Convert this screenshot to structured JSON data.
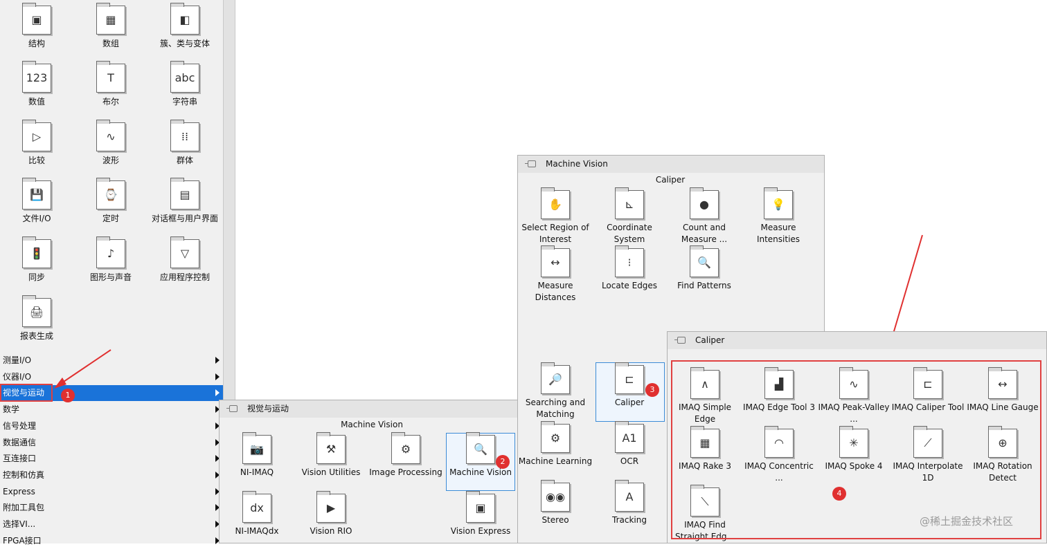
{
  "left_palette": {
    "grid_items": [
      {
        "label": "结构",
        "icon": "structure-icon",
        "glyph": "▣"
      },
      {
        "label": "数组",
        "icon": "array-icon",
        "glyph": "▦"
      },
      {
        "label": "簇、类与变体",
        "icon": "cluster-icon",
        "glyph": "◧"
      },
      {
        "label": "数值",
        "icon": "numeric-icon",
        "glyph": "123"
      },
      {
        "label": "布尔",
        "icon": "boolean-icon",
        "glyph": "T"
      },
      {
        "label": "字符串",
        "icon": "string-icon",
        "glyph": "abc"
      },
      {
        "label": "比较",
        "icon": "comparison-icon",
        "glyph": "▷"
      },
      {
        "label": "波形",
        "icon": "waveform-icon",
        "glyph": "∿"
      },
      {
        "label": "群体",
        "icon": "group-icon",
        "glyph": "⁞⁞"
      },
      {
        "label": "文件I/O",
        "icon": "file-io-icon",
        "glyph": "💾"
      },
      {
        "label": "定时",
        "icon": "timing-icon",
        "glyph": "⌚"
      },
      {
        "label": "对话框与用户界面",
        "icon": "dialog-ui-icon",
        "glyph": "▤"
      },
      {
        "label": "同步",
        "icon": "sync-icon",
        "glyph": "🚦"
      },
      {
        "label": "图形与声音",
        "icon": "graphics-sound-icon",
        "glyph": "♪"
      },
      {
        "label": "应用程序控制",
        "icon": "app-control-icon",
        "glyph": "▽"
      },
      {
        "label": "报表生成",
        "icon": "report-icon",
        "glyph": "🖨"
      }
    ],
    "categories": [
      {
        "label": "测量I/O",
        "selected": false
      },
      {
        "label": "仪器I/O",
        "selected": false
      },
      {
        "label": "视觉与运动",
        "selected": true
      },
      {
        "label": "数学",
        "selected": false
      },
      {
        "label": "信号处理",
        "selected": false
      },
      {
        "label": "数据通信",
        "selected": false
      },
      {
        "label": "互连接口",
        "selected": false
      },
      {
        "label": "控制和仿真",
        "selected": false
      },
      {
        "label": "Express",
        "selected": false
      },
      {
        "label": "附加工具包",
        "selected": false
      },
      {
        "label": "选择VI...",
        "selected": false
      },
      {
        "label": "FPGA接口",
        "selected": false
      }
    ]
  },
  "vision_palette": {
    "title": "视觉与运动",
    "section": "Machine Vision",
    "items": [
      {
        "label": "NI-IMAQ",
        "icon": "ni-imaq-icon",
        "glyph": "📷"
      },
      {
        "label": "Vision Utilities",
        "icon": "vision-utilities-icon",
        "glyph": "⚒"
      },
      {
        "label": "Image Processing",
        "icon": "image-processing-icon",
        "glyph": "⚙"
      },
      {
        "label": "Machine Vision",
        "icon": "machine-vision-icon",
        "glyph": "🔍"
      },
      {
        "label": "NI-IMAQdx",
        "icon": "ni-imaqdx-icon",
        "glyph": "dx"
      },
      {
        "label": "Vision RIO",
        "icon": "vision-rio-icon",
        "glyph": "▶"
      },
      {
        "label": "Vision Express",
        "icon": "vision-express-icon",
        "glyph": "▣"
      }
    ]
  },
  "mv_palette": {
    "title": "Machine Vision",
    "section": "Caliper",
    "items": [
      {
        "label": "Select Region of Interest",
        "icon": "select-roi-icon",
        "glyph": "✋"
      },
      {
        "label": "Coordinate System",
        "icon": "coordinate-system-icon",
        "glyph": "⊾"
      },
      {
        "label": "Count and Measure ...",
        "icon": "count-measure-icon",
        "glyph": "●"
      },
      {
        "label": "Measure Intensities",
        "icon": "measure-intensities-icon",
        "glyph": "💡"
      },
      {
        "label": "Measure Distances",
        "icon": "measure-distances-icon",
        "glyph": "↔"
      },
      {
        "label": "Locate Edges",
        "icon": "locate-edges-icon",
        "glyph": "⁝"
      },
      {
        "label": "Find Patterns",
        "icon": "find-patterns-icon",
        "glyph": "🔍"
      },
      {
        "label": "Searching and Matching",
        "icon": "searching-matching-icon",
        "glyph": "🔎"
      },
      {
        "label": "Caliper",
        "icon": "caliper-icon",
        "glyph": "⊏"
      },
      {
        "label": "Machine Learning",
        "icon": "machine-learning-icon",
        "glyph": "⚙"
      },
      {
        "label": "OCR",
        "icon": "ocr-icon",
        "glyph": "A1"
      },
      {
        "label": "Stereo",
        "icon": "stereo-icon",
        "glyph": "◉◉"
      },
      {
        "label": "Tracking",
        "icon": "tracking-icon",
        "glyph": "A"
      }
    ]
  },
  "caliper_palette": {
    "title": "Caliper",
    "items": [
      {
        "label": "IMAQ Simple Edge",
        "icon": "simple-edge-icon",
        "glyph": "∧"
      },
      {
        "label": "IMAQ Edge Tool 3",
        "icon": "edge-tool-icon",
        "glyph": "▟"
      },
      {
        "label": "IMAQ Peak-Valley ...",
        "icon": "peak-valley-icon",
        "glyph": "∿"
      },
      {
        "label": "IMAQ Caliper Tool",
        "icon": "caliper-tool-icon",
        "glyph": "⊏"
      },
      {
        "label": "IMAQ Line Gauge",
        "icon": "line-gauge-icon",
        "glyph": "↔"
      },
      {
        "label": "IMAQ Rake 3",
        "icon": "rake-icon",
        "glyph": "▦"
      },
      {
        "label": "IMAQ Concentric ...",
        "icon": "concentric-icon",
        "glyph": "◠"
      },
      {
        "label": "IMAQ Spoke 4",
        "icon": "spoke-icon",
        "glyph": "✳"
      },
      {
        "label": "IMAQ Interpolate 1D",
        "icon": "interpolate-icon",
        "glyph": "⟋"
      },
      {
        "label": "IMAQ Rotation Detect",
        "icon": "rotation-detect-icon",
        "glyph": "⊕"
      },
      {
        "label": "IMAQ Find Straight Edg...",
        "icon": "find-straight-edge-icon",
        "glyph": "⟍"
      }
    ]
  },
  "badges": [
    "1",
    "2",
    "3",
    "4"
  ],
  "watermark": "@稀土掘金技术社区",
  "colors": {
    "selection": "#1a73d9",
    "badge": "#e03030",
    "highlight_box": "#e04040"
  }
}
